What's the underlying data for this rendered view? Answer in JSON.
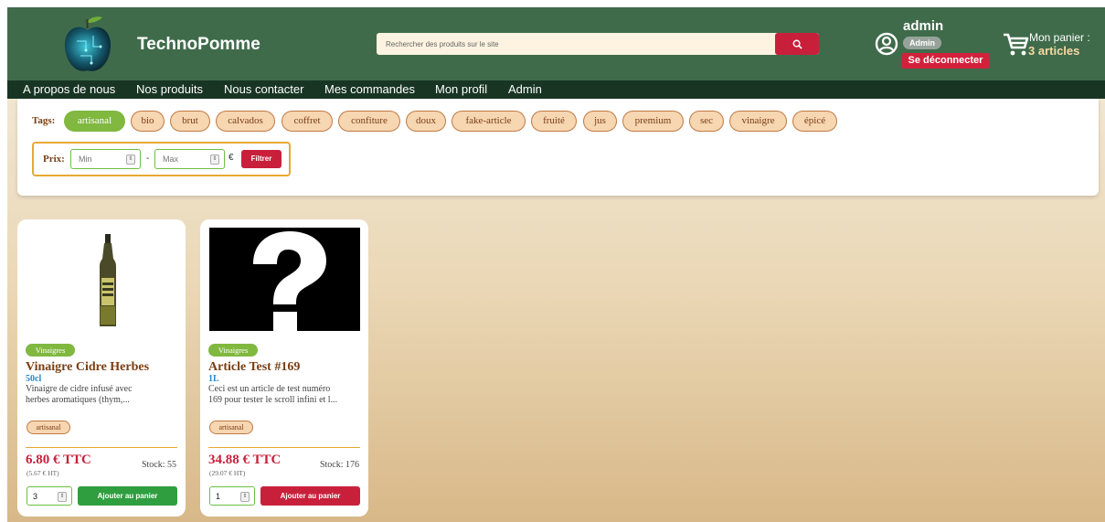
{
  "brand": {
    "name": "TechnoPomme"
  },
  "search": {
    "placeholder": "Rechercher des produits sur le site"
  },
  "user": {
    "name": "admin",
    "role": "Admin",
    "logout_label": "Se déconnecter"
  },
  "cart": {
    "title": "Mon panier :",
    "count": "3 articles"
  },
  "nav": [
    {
      "label": "A propos de nous"
    },
    {
      "label": "Nos produits"
    },
    {
      "label": "Nous contacter"
    },
    {
      "label": "Mes commandes"
    },
    {
      "label": "Mon profil"
    },
    {
      "label": "Admin"
    }
  ],
  "filters": {
    "tags_label": "Tags:",
    "tags": [
      {
        "label": "artisanal",
        "active": true
      },
      {
        "label": "bio",
        "active": false
      },
      {
        "label": "brut",
        "active": false
      },
      {
        "label": "calvados",
        "active": false
      },
      {
        "label": "coffret",
        "active": false
      },
      {
        "label": "confiture",
        "active": false
      },
      {
        "label": "doux",
        "active": false
      },
      {
        "label": "fake-article",
        "active": false
      },
      {
        "label": "fruité",
        "active": false
      },
      {
        "label": "jus",
        "active": false
      },
      {
        "label": "premium",
        "active": false
      },
      {
        "label": "sec",
        "active": false
      },
      {
        "label": "vinaigre",
        "active": false
      },
      {
        "label": "épicé",
        "active": false
      }
    ],
    "price_label": "Prix:",
    "min_placeholder": "Min",
    "max_placeholder": "Max",
    "dash": "-",
    "currency": "€",
    "filter_button": "Filtrer"
  },
  "products": [
    {
      "category": "Vinaigres",
      "title": "Vinaigre Cidre Herbes",
      "volume": "50cl",
      "desc_line1": "Vinaigre de cidre infusé avec",
      "desc_line2": "herbes aromatiques (thym,...",
      "tag": "artisanal",
      "price": "6.80 € TTC",
      "price_ht": "(5.67 € HT)",
      "stock": "Stock: 55",
      "qty": "3",
      "button": "Ajouter au panier",
      "button_color": "#2f9e3f"
    },
    {
      "category": "Vinaigres",
      "title": "Article Test #169",
      "volume": "1L",
      "desc_line1": "Ceci est un article de test numéro",
      "desc_line2": "169 pour tester le scroll infini et l...",
      "tag": "artisanal",
      "price": "34.88 € TTC",
      "price_ht": "(29.07 € HT)",
      "stock": "Stock: 176",
      "qty": "1",
      "button": "Ajouter au panier",
      "button_color": "#c8203b"
    }
  ]
}
